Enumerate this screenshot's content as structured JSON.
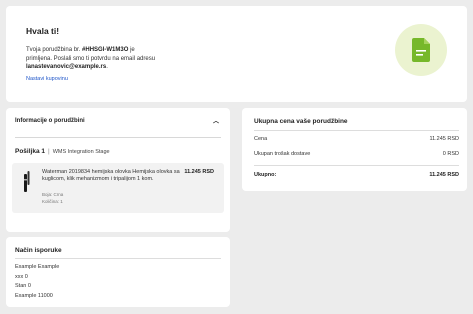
{
  "thanks": {
    "title": "Hvala ti!",
    "message_prefix": "Tvoja porudžbina br.",
    "order_number": "#HHSGI-W1M3O",
    "message_mid": "je primljena. Poslali smo ti potvrdu na email adresu",
    "email": "lanastevanovic@example.rs",
    "message_suffix": ".",
    "continue_link": "Nastavi kupovinu",
    "icon": "document-check-icon",
    "accent_color": "#76b82a"
  },
  "order_info": {
    "header": "Informacije o porudžbini",
    "shipment_label": "Pošiljka 1",
    "shipment_separator": "|",
    "shipment_stage": "WMS Integration Stage",
    "item": {
      "name": "Waterman 2019834 hemijska olovka Hemijska olovka sa kuglicom, klik mehanizmom i tripalijom 1 kom.",
      "color": "Boja: Crna",
      "quantity": "Količina: 1",
      "price": "11.245 RSD"
    }
  },
  "summary": {
    "title": "Ukupna cena vaše porudžbine",
    "price_label": "Cena",
    "price_value": "11.245 RSD",
    "shipping_label": "Ukupan trošak dostave",
    "shipping_value": "0 RSD",
    "total_label": "Ukupno:",
    "total_value": "11.245 RSD"
  },
  "delivery": {
    "title": "Način isporuke",
    "lines": [
      "Example Example",
      "xxx 0",
      "Stan 0",
      "Example 11000"
    ]
  }
}
